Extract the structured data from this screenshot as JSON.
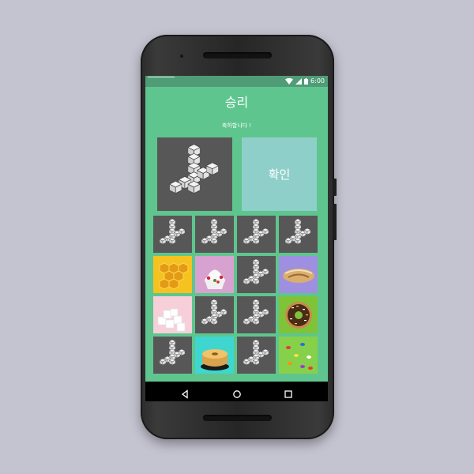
{
  "status_bar": {
    "time": "6:00",
    "icons": [
      "wifi-icon",
      "signal-icon",
      "battery-icon"
    ]
  },
  "dialog": {
    "title": "승리",
    "subtitle": "축하합니다 !",
    "confirm_label": "확인",
    "hero_image": "blocks-logo-icon"
  },
  "board": {
    "cards": [
      {
        "state": "back",
        "image": "blocks-logo-icon"
      },
      {
        "state": "back",
        "image": "blocks-logo-icon"
      },
      {
        "state": "back",
        "image": "blocks-logo-icon"
      },
      {
        "state": "back",
        "image": "blocks-logo-icon"
      },
      {
        "state": "front",
        "image": "honeycomb"
      },
      {
        "state": "front",
        "image": "frozen-yogurt"
      },
      {
        "state": "back",
        "image": "blocks-logo-icon"
      },
      {
        "state": "front",
        "image": "pastry-roll"
      },
      {
        "state": "front",
        "image": "sugar-cubes"
      },
      {
        "state": "back",
        "image": "blocks-logo-icon"
      },
      {
        "state": "back",
        "image": "blocks-logo-icon"
      },
      {
        "state": "front",
        "image": "chocolate-donut"
      },
      {
        "state": "back",
        "image": "blocks-logo-icon"
      },
      {
        "state": "front",
        "image": "chiffon-cake"
      },
      {
        "state": "back",
        "image": "blocks-logo-icon"
      },
      {
        "state": "front",
        "image": "jelly-beans"
      }
    ]
  },
  "nav_bar": {
    "buttons": [
      "back-icon",
      "home-icon",
      "recents-icon"
    ]
  },
  "colors": {
    "background": "#c4c3d0",
    "screen": "#5fc58f",
    "status_bar": "#4f9c77",
    "tile": "#575757",
    "confirm": "#8fcfc9"
  }
}
